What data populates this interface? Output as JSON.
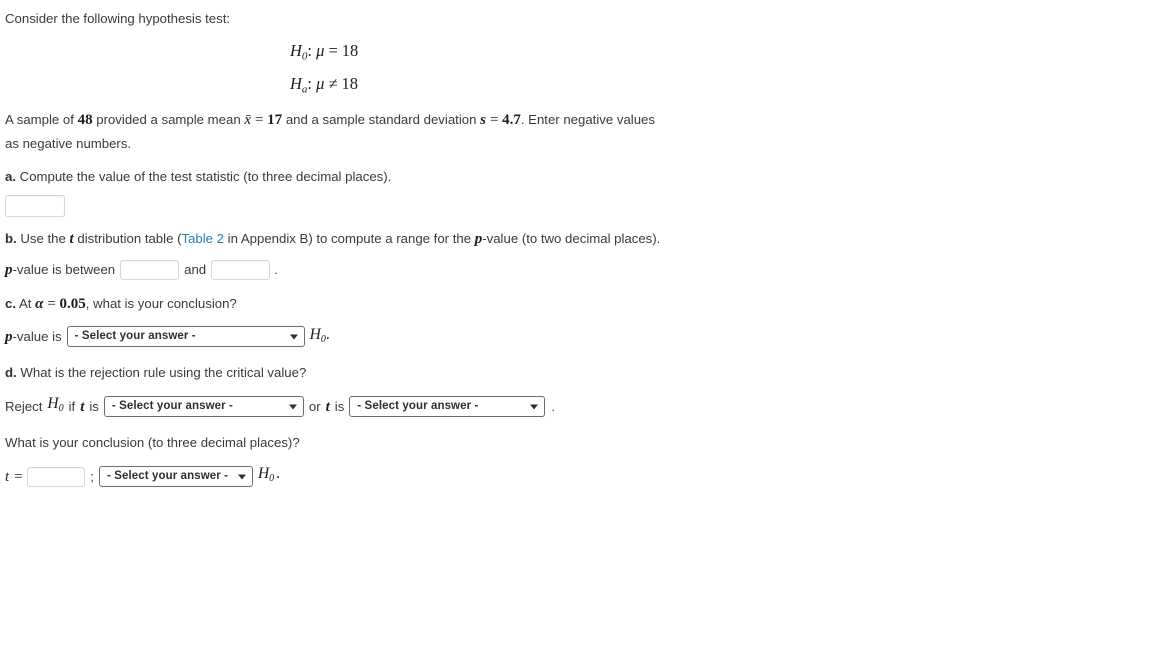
{
  "intro": {
    "prompt": "Consider the following hypothesis test:"
  },
  "hypotheses": {
    "null": {
      "symbol": "H",
      "subscript": "0",
      "param": "μ",
      "operator": "=",
      "value": "18"
    },
    "alt": {
      "symbol": "H",
      "subscript": "a",
      "param": "μ",
      "operator": "≠",
      "value": "18"
    }
  },
  "sample": {
    "text_1": "A sample of",
    "n": "48",
    "text_2": "provided a sample mean",
    "xbar_symbol": "x̄",
    "xbar_eq": "=",
    "xbar": "17",
    "text_3": "and a sample standard deviation",
    "s_symbol": "s",
    "s_eq": "=",
    "s": "4.7",
    "text_4": ". Enter negative values as negative numbers."
  },
  "part_a": {
    "label": "a.",
    "text": "Compute the value of the test statistic (to three decimal places).",
    "answer_value": "",
    "answer_placeholder": ""
  },
  "part_b": {
    "label": "b.",
    "text_1": "Use the",
    "t_symbol": "t",
    "text_2": "distribution table (",
    "link_text": "Table 2",
    "text_3": "in Appendix B) to compute a range for the",
    "p_symbol": "p",
    "text_4": "-value (to two decimal places).",
    "range_prefix_p": "p",
    "range_prefix": "-value is between",
    "range_joiner": "and",
    "range_suffix": ".",
    "lower_value": "",
    "upper_value": ""
  },
  "part_c": {
    "label": "c.",
    "text_1": "At",
    "alpha_symbol": "α",
    "alpha_eq": "=",
    "alpha_value": "0.05",
    "text_2": ", what is your conclusion?",
    "row_prefix_p": "p",
    "row_prefix": "-value is",
    "select_value": "- Select your answer -",
    "h_symbol": "H",
    "h_sub": "0",
    "row_suffix": "."
  },
  "part_d": {
    "label": "d.",
    "text": "What is the rejection rule using the critical value?",
    "reject_text": "Reject",
    "h_symbol": "H",
    "h_sub": "0",
    "if_text": "if",
    "t_symbol": "t",
    "is_text": "is",
    "select_1_value": "- Select your answer -",
    "or_text": "or",
    "t_symbol_2": "t",
    "is_text_2": "is",
    "select_2_value": "- Select your answer -",
    "suffix": "."
  },
  "conclusion": {
    "question": "What is your conclusion (to three decimal places)?",
    "t_symbol": "t",
    "t_eq": "=",
    "t_value": "",
    "semicolon": ";",
    "select_value": "- Select your answer -",
    "h_symbol": "H",
    "h_sub": "0",
    "suffix": "."
  },
  "colors": {
    "link": "#2f7cb5",
    "text": "#3a3a38",
    "math": "#1d1d1b",
    "input_border": "#d7d7d7",
    "select_border": "#6d6d6d"
  }
}
